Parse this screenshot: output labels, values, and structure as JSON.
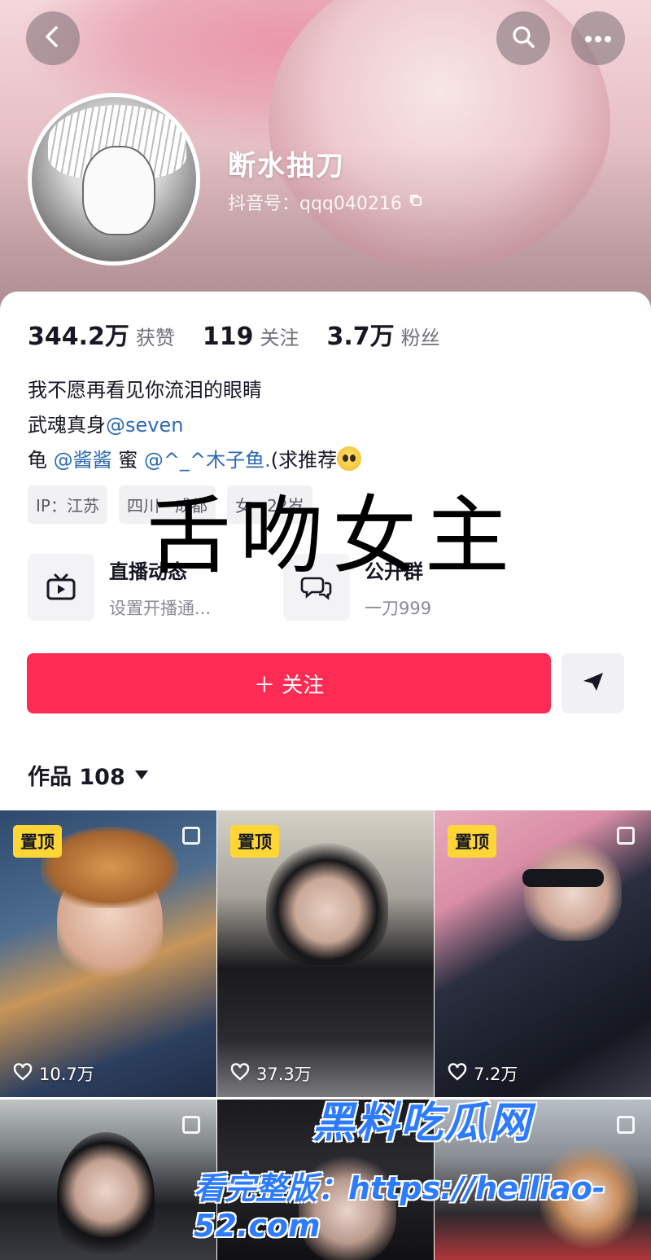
{
  "profile": {
    "username": "断水抽刀",
    "douyin_id": "抖音号：qqq040216",
    "copy_icon": "copy-icon"
  },
  "stats": {
    "likes_value": "344.2万",
    "likes_label": "获赞",
    "following_value": "119",
    "following_label": "关注",
    "followers_value": "3.7万",
    "followers_label": "粉丝"
  },
  "bio": {
    "line1": "我不愿再看见你流泪的眼睛",
    "line2_prefix": "武魂真身",
    "line2_mention": "@seven",
    "line3_prefix": "龟",
    "line3_mention1": "@酱酱",
    "line3_mid": "蜜",
    "line3_mention2": "@^_^木子鱼.",
    "line3_suffix": "(求推荐"
  },
  "tags": [
    "IP：江苏",
    "四川 · 成都",
    "女 · 22岁"
  ],
  "overlay_title": "舌吻女主",
  "features": {
    "live_title": "直播动态",
    "live_sub": "设置开播通...",
    "group_title": "公开群",
    "group_sub": "一刀999"
  },
  "actions": {
    "follow_label": "＋ 关注",
    "share_icon": "send-icon"
  },
  "works": {
    "label": "作品 108"
  },
  "videos": [
    {
      "pinned": "置顶",
      "likes": "10.7万"
    },
    {
      "pinned": "置顶",
      "likes": "37.3万"
    },
    {
      "pinned": "置顶",
      "likes": "7.2万"
    },
    {
      "pinned": "",
      "likes": ""
    },
    {
      "pinned": "",
      "likes": ""
    },
    {
      "pinned": "",
      "likes": ""
    }
  ],
  "watermark": {
    "brand": "黑料吃瓜网",
    "url": "看完整版：https://heiliao-52.com",
    "site": ""
  },
  "colors": {
    "accent": "#fe2c55",
    "mention": "#2c6ab3",
    "pin_badge": "#ffd635",
    "watermark": "#2d7bff"
  }
}
